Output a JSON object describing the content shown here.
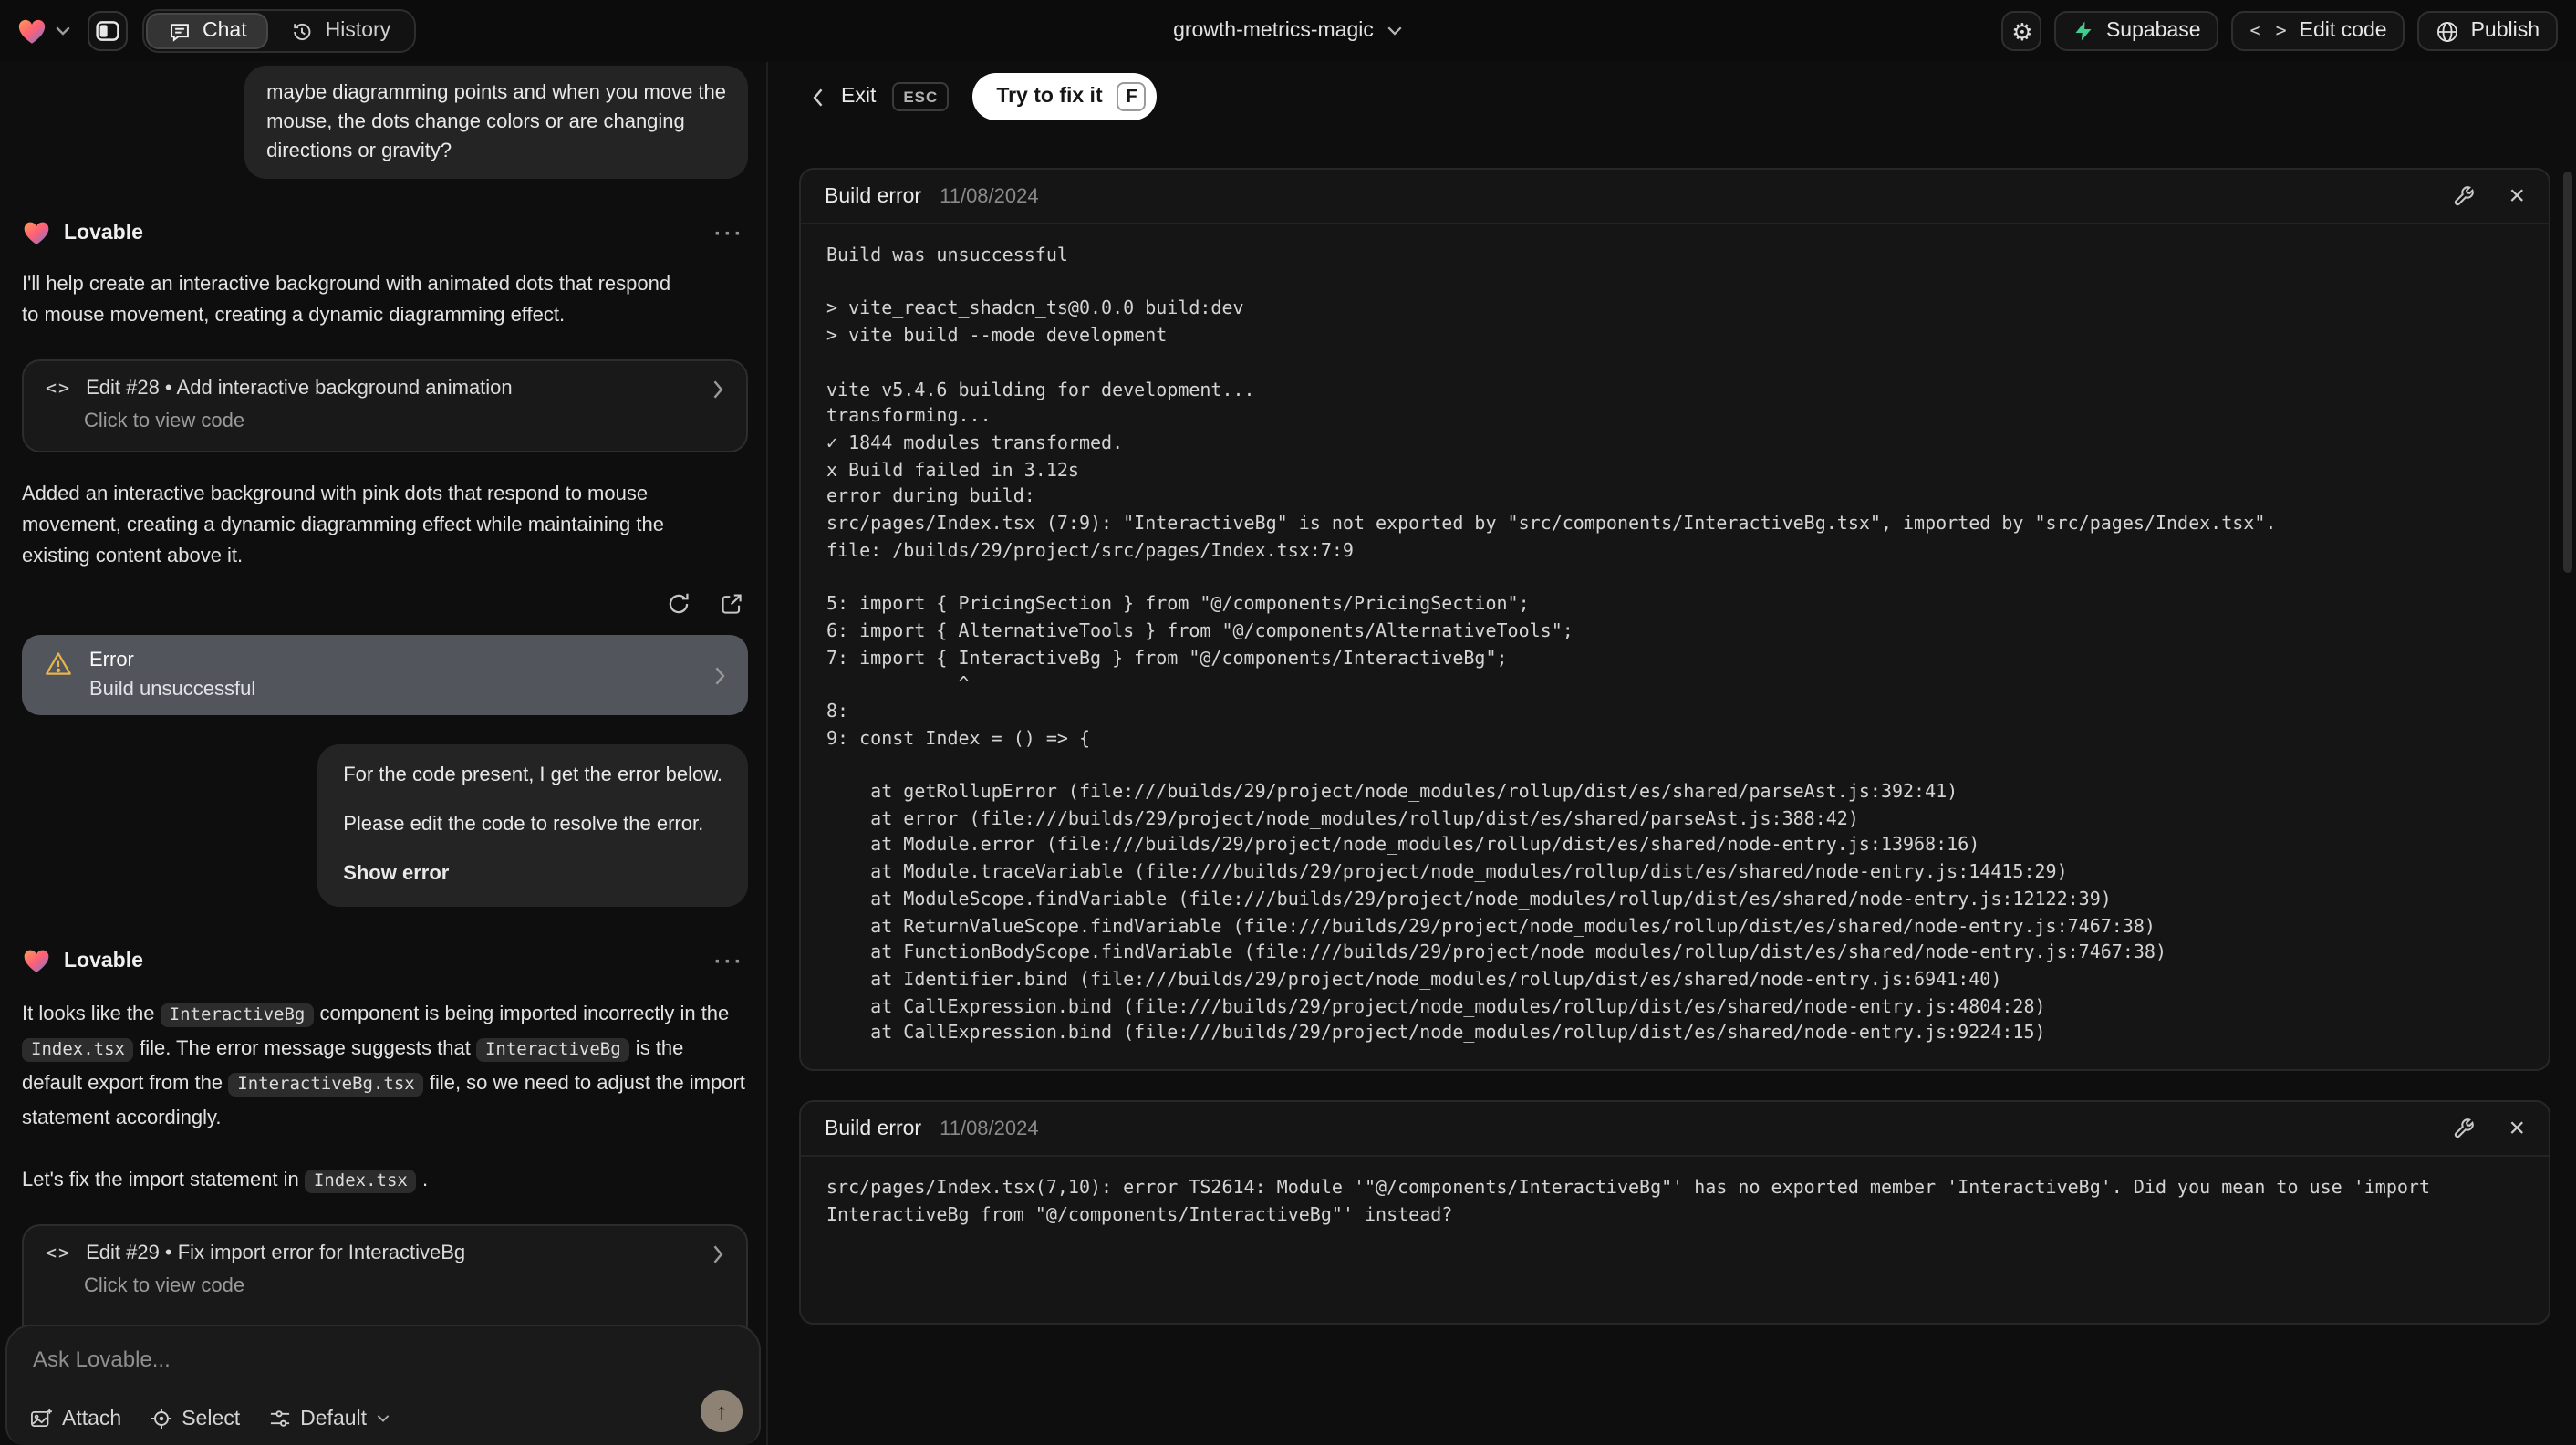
{
  "topbar": {
    "tabs": {
      "chat": "Chat",
      "history": "History"
    },
    "project": "growth-metrics-magic",
    "supabase": "Supabase",
    "edit_code": "Edit code",
    "edit_code_icon": "< >",
    "publish": "Publish",
    "gear_glyph": "⚙"
  },
  "chat": {
    "assistant_name": "Lovable",
    "more_glyph": "···",
    "user_message_1": "maybe diagramming points and when you move the\nmouse, the dots change colors or are changing\ndirections or gravity?",
    "assistant_intro": "I'll help create an interactive background with animated dots that respond\nto mouse movement, creating a dynamic diagramming effect.",
    "edit_28": {
      "icon": "<>",
      "title": "Edit #28 • Add interactive background animation",
      "subtitle": "Click to view code"
    },
    "assistant_summary": "Added an interactive background with pink dots that respond to mouse\nmovement, creating a dynamic diagramming effect while maintaining the\nexisting content above it.",
    "error_card": {
      "title": "Error",
      "subtitle": "Build unsuccessful"
    },
    "user_message_2": {
      "line1": "For the code present, I get the error below.",
      "line2": "Please edit the code to resolve the error.",
      "action": "Show error"
    },
    "assistant_diagnosis": [
      {
        "text": "It looks like the "
      },
      {
        "code": "InteractiveBg"
      },
      {
        "text": " component is being imported incorrectly in the "
      },
      {
        "code": "Index.tsx"
      },
      {
        "text": " file. The error message suggests that "
      },
      {
        "code": "InteractiveBg"
      },
      {
        "text": " is the default export from the "
      },
      {
        "code": "InteractiveBg.tsx"
      },
      {
        "text": " file, so we need to adjust the import statement accordingly."
      }
    ],
    "assistant_fix": [
      {
        "text": "Let's fix the import statement in "
      },
      {
        "code": "Index.tsx"
      },
      {
        "text": " ."
      }
    ],
    "edit_29": {
      "icon": "<>",
      "title": "Edit #29 • Fix import error for InteractiveBg",
      "subtitle": "Click to view code"
    },
    "input": {
      "placeholder": "Ask Lovable...",
      "attach": "Attach",
      "select": "Select",
      "mode": "Default",
      "send_glyph": "↑"
    }
  },
  "fix_bar": {
    "exit": "Exit",
    "esc_key": "ESC",
    "fix": "Try to fix it",
    "fix_key": "F"
  },
  "panels": [
    {
      "title": "Build error",
      "date": "11/08/2024",
      "close_glyph": "×",
      "log": "Build was unsuccessful\n\n> vite_react_shadcn_ts@0.0.0 build:dev\n> vite build --mode development\n\nvite v5.4.6 building for development...\ntransforming...\n✓ 1844 modules transformed.\nx Build failed in 3.12s\nerror during build:\nsrc/pages/Index.tsx (7:9): \"InteractiveBg\" is not exported by \"src/components/InteractiveBg.tsx\", imported by \"src/pages/Index.tsx\".\nfile: /builds/29/project/src/pages/Index.tsx:7:9\n\n5: import { PricingSection } from \"@/components/PricingSection\";\n6: import { AlternativeTools } from \"@/components/AlternativeTools\";\n7: import { InteractiveBg } from \"@/components/InteractiveBg\";\n            ^\n8: \n9: const Index = () => {\n\n    at getRollupError (file:///builds/29/project/node_modules/rollup/dist/es/shared/parseAst.js:392:41)\n    at error (file:///builds/29/project/node_modules/rollup/dist/es/shared/parseAst.js:388:42)\n    at Module.error (file:///builds/29/project/node_modules/rollup/dist/es/shared/node-entry.js:13968:16)\n    at Module.traceVariable (file:///builds/29/project/node_modules/rollup/dist/es/shared/node-entry.js:14415:29)\n    at ModuleScope.findVariable (file:///builds/29/project/node_modules/rollup/dist/es/shared/node-entry.js:12122:39)\n    at ReturnValueScope.findVariable (file:///builds/29/project/node_modules/rollup/dist/es/shared/node-entry.js:7467:38)\n    at FunctionBodyScope.findVariable (file:///builds/29/project/node_modules/rollup/dist/es/shared/node-entry.js:7467:38)\n    at Identifier.bind (file:///builds/29/project/node_modules/rollup/dist/es/shared/node-entry.js:6941:40)\n    at CallExpression.bind (file:///builds/29/project/node_modules/rollup/dist/es/shared/node-entry.js:4804:28)\n    at CallExpression.bind (file:///builds/29/project/node_modules/rollup/dist/es/shared/node-entry.js:9224:15)"
    },
    {
      "title": "Build error",
      "date": "11/08/2024",
      "close_glyph": "×",
      "log": "src/pages/Index.tsx(7,10): error TS2614: Module '\"@/components/InteractiveBg\"' has no exported member 'InteractiveBg'. Did you mean to use 'import\nInteractiveBg from \"@/components/InteractiveBg\"' instead?"
    }
  ],
  "colors": {
    "supabase_green": "#3ecf8e",
    "warning_amber": "#e8b44c",
    "send_button": "#8e8274"
  }
}
